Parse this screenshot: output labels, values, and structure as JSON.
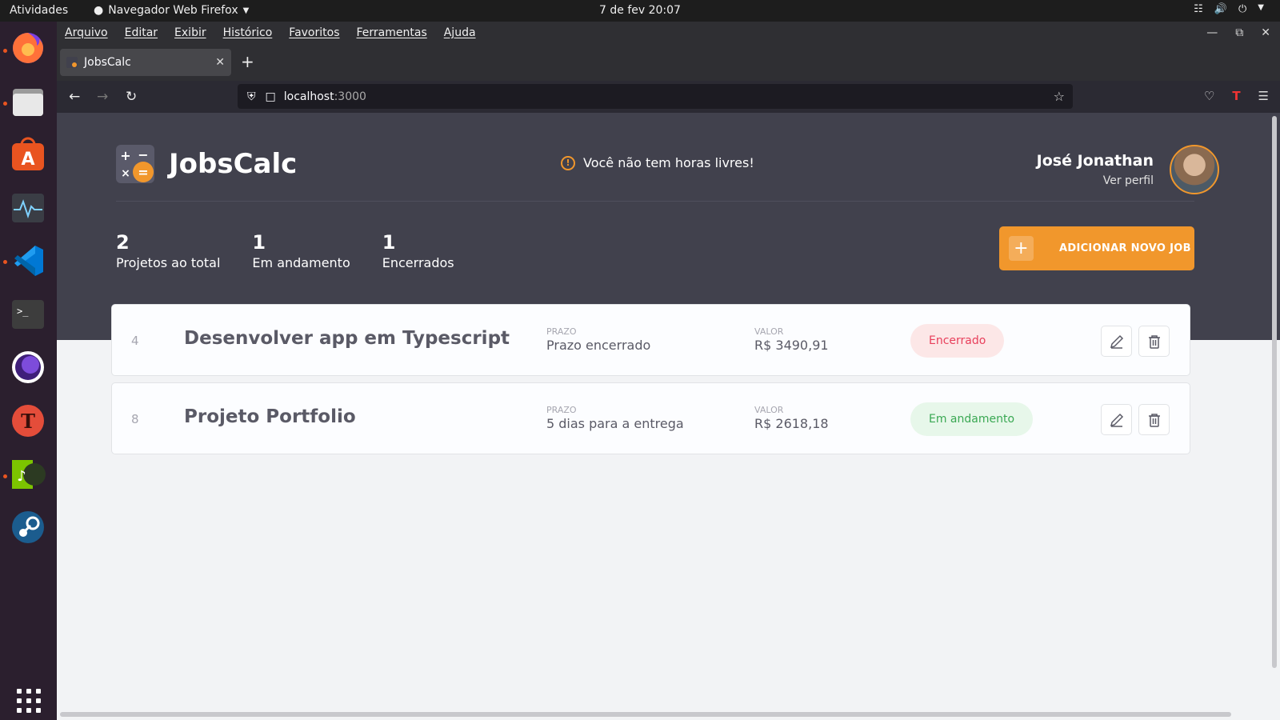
{
  "system": {
    "activities": "Atividades",
    "app_menu": "Navegador Web Firefox",
    "clock": "7 de fev  20:07"
  },
  "dock": {
    "items": [
      "firefox-icon",
      "files-icon",
      "app-center-icon",
      "system-monitor-icon",
      "vscode-icon",
      "terminal-icon",
      "tor-browser-icon",
      "typora-icon",
      "music-player-icon",
      "steam-icon"
    ]
  },
  "browser": {
    "menu": [
      "Arquivo",
      "Editar",
      "Exibir",
      "Histórico",
      "Favoritos",
      "Ferramentas",
      "Ajuda"
    ],
    "tab_title": "JobsCalc",
    "url_host": "localhost",
    "url_port": ":3000"
  },
  "app": {
    "brand": "JobsCalc",
    "notice": "Você não tem horas livres!",
    "user_name": "José Jonathan",
    "user_link": "Ver perfil",
    "stats": [
      {
        "value": "2",
        "label": "Projetos ao total"
      },
      {
        "value": "1",
        "label": "Em andamento"
      },
      {
        "value": "1",
        "label": "Encerrados"
      }
    ],
    "add_button": "ADICIONAR NOVO JOB",
    "deadline_label": "PRAZO",
    "value_label": "VALOR",
    "jobs": [
      {
        "id": "4",
        "name": "Desenvolver app em Typescript",
        "deadline": "Prazo encerrado",
        "value": "R$ 3490,91",
        "status": "Encerrado"
      },
      {
        "id": "8",
        "name": "Projeto Portfolio",
        "deadline": "5 dias para a entrega",
        "value": "R$ 2618,18",
        "status": "Em andamento"
      }
    ]
  },
  "colors": {
    "accent": "#f1972c",
    "header_bg": "#41414d",
    "closed_badge": "#e83f5b",
    "progress_badge": "#3aa853"
  }
}
